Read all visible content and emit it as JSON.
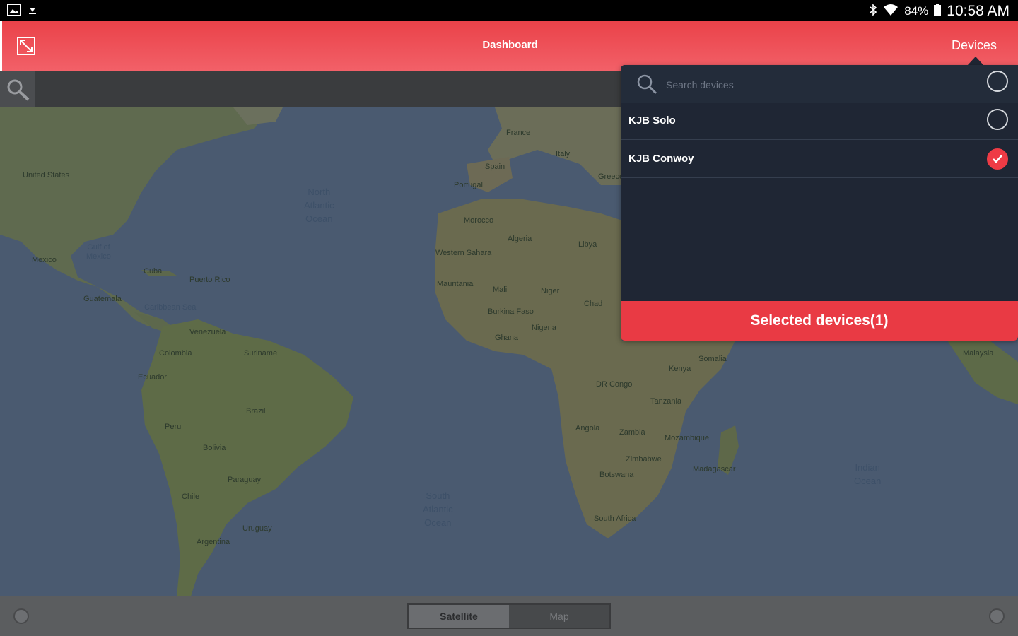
{
  "status_bar": {
    "left_icons": [
      "image-icon",
      "download-icon"
    ],
    "right_icons": [
      "bluetooth-icon",
      "wifi-icon",
      "battery-icon"
    ],
    "battery": "84%",
    "time": "10:58 AM"
  },
  "header": {
    "title": "Dashboard",
    "devices_label": "Devices",
    "background": "#ec4a52"
  },
  "map": {
    "view_toggle": {
      "satellite": "Satellite",
      "map": "Map",
      "selected": "Satellite"
    },
    "country_labels": [
      "United States",
      "Mexico",
      "Cuba",
      "Puerto Rico",
      "Guatemala",
      "Venezuela",
      "Colombia",
      "Suriname",
      "Ecuador",
      "Brazil",
      "Peru",
      "Bolivia",
      "Paraguay",
      "Chile",
      "Argentina",
      "Uruguay",
      "France",
      "Spain",
      "Portugal",
      "Italy",
      "Greece",
      "Morocco",
      "Algeria",
      "Libya",
      "Western Sahara",
      "Mauritania",
      "Mali",
      "Niger",
      "Chad",
      "Burkina Faso",
      "Nigeria",
      "Ghana",
      "DR Congo",
      "Angola",
      "Zambia",
      "Tanzania",
      "Kenya",
      "Somalia",
      "Zimbabwe",
      "Mozambique",
      "Botswana",
      "South Africa",
      "Madagascar",
      "Malaysia"
    ],
    "ocean_labels": [
      "North\nAtlantic\nOcean",
      "South\nAtlantic\nOcean",
      "Indian\nOcean",
      "Gulf of\nMexico",
      "Caribbean Sea"
    ]
  },
  "devices_panel": {
    "search_placeholder": "Search devices",
    "devices": [
      {
        "name": "KJB Solo",
        "selected": false
      },
      {
        "name": "KJB Conwoy",
        "selected": true
      }
    ],
    "selected_button": "Selected devices(1)",
    "accent": "#ef3b45"
  }
}
